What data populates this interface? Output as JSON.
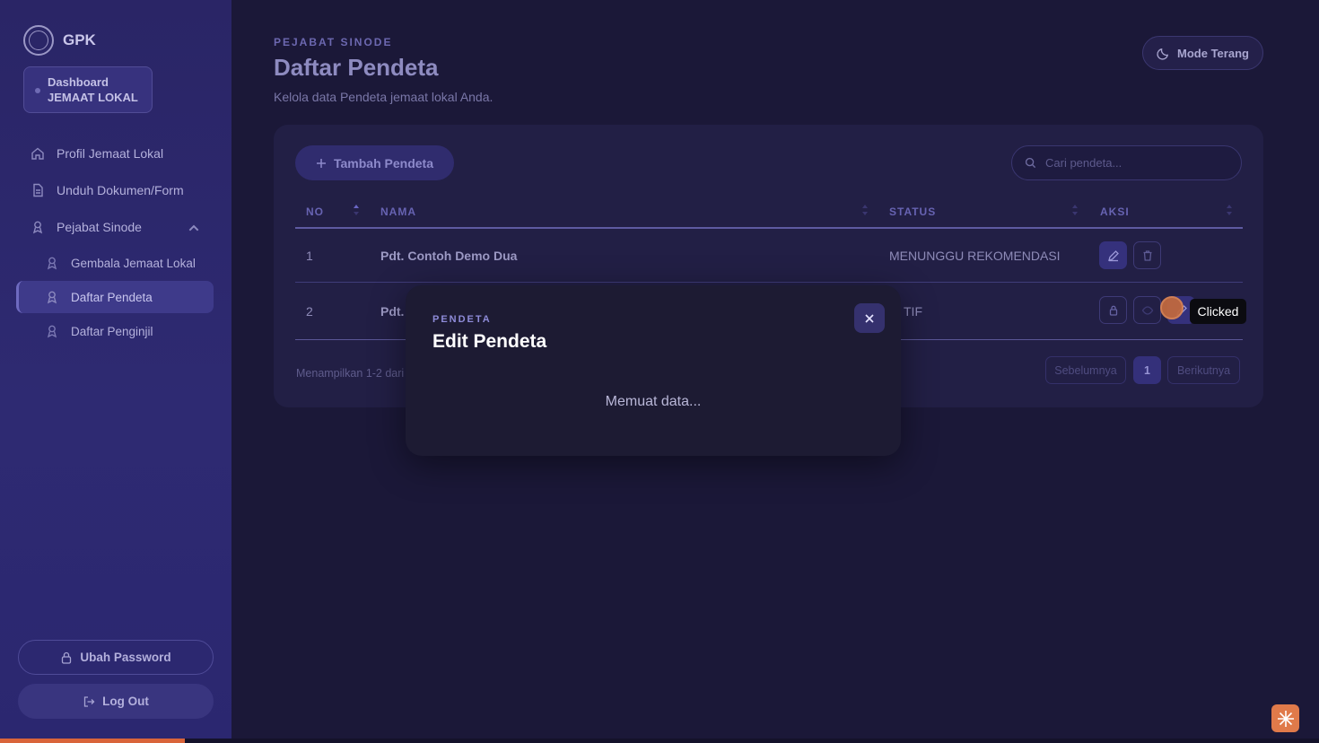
{
  "brand": {
    "name": "GPK"
  },
  "dashboard_card": {
    "line1": "Dashboard",
    "line2": "JEMAAT LOKAL"
  },
  "nav": {
    "items": [
      {
        "label": "Profil Jemaat Lokal",
        "icon": "home-icon"
      },
      {
        "label": "Unduh Dokumen/Form",
        "icon": "document-icon"
      },
      {
        "label": "Pejabat Sinode",
        "icon": "user-badge-icon",
        "expanded": true
      }
    ],
    "sub_items": [
      {
        "label": "Gembala Jemaat Lokal",
        "icon": "user-badge-icon"
      },
      {
        "label": "Daftar Pendeta",
        "icon": "user-badge-icon",
        "active": true
      },
      {
        "label": "Daftar Penginjil",
        "icon": "user-badge-icon"
      }
    ]
  },
  "sidebar_actions": {
    "change_password": "Ubah Password",
    "logout": "Log Out"
  },
  "header": {
    "eyebrow": "PEJABAT SINODE",
    "title": "Daftar Pendeta",
    "subtitle": "Kelola data Pendeta jemaat lokal Anda.",
    "mode_toggle": "Mode Terang"
  },
  "toolbar": {
    "add_label": "Tambah Pendeta",
    "search_placeholder": "Cari pendeta..."
  },
  "table": {
    "columns": [
      "NO",
      "NAMA",
      "STATUS",
      "AKSI"
    ],
    "rows": [
      {
        "no": "1",
        "name": "Pdt. Contoh Demo Dua",
        "status": "MENUNGGU REKOMENDASI"
      },
      {
        "no": "2",
        "name": "Pdt.",
        "status": "TIF"
      }
    ]
  },
  "footer": {
    "showing": "Menampilkan 1-2 dari",
    "prev": "Sebelumnya",
    "page": "1",
    "next": "Berikutnya"
  },
  "modal": {
    "eyebrow": "PENDETA",
    "title": "Edit Pendeta",
    "loading": "Memuat data..."
  },
  "click_indicator": {
    "label": "Clicked"
  },
  "progress": {
    "fraction": 0.14
  },
  "colors": {
    "accent": "#6763b2",
    "sidebar": "#2a2566",
    "background": "#1b1838",
    "click": "#c0683f"
  }
}
